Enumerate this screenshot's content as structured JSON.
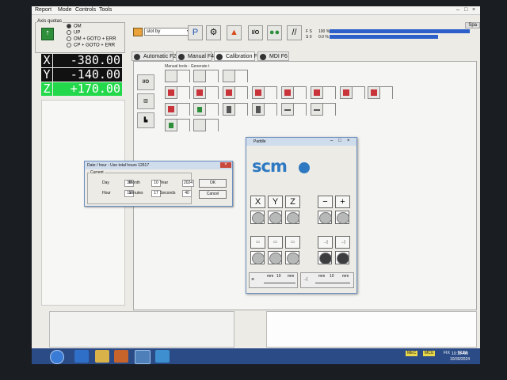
{
  "menu": {
    "items": [
      "Report",
      "Mode",
      "Controls",
      "Tools"
    ]
  },
  "axes_options": {
    "title": "Axis quotas",
    "options": [
      {
        "label": "OM",
        "selected": true
      },
      {
        "label": "UP",
        "selected": false
      },
      {
        "label": "OM + GOTO + ERR",
        "selected": false
      },
      {
        "label": "CP + GOTO + ERR",
        "selected": false
      }
    ]
  },
  "coords": [
    {
      "axis": "X",
      "value": "-380.00"
    },
    {
      "axis": "Y",
      "value": "-140.00"
    },
    {
      "axis": "Z",
      "value": "+170.00"
    }
  ],
  "toolbar": {
    "mode_select": "slot by"
  },
  "status": {
    "rows": [
      {
        "label": "F S",
        "text": "100 %",
        "fill": 0.93
      },
      {
        "label": "S 0",
        "text": "0.0 %",
        "fill": 0.72
      }
    ],
    "panel_title": "Spa"
  },
  "tabs": [
    {
      "label": "Automatic F2",
      "active": false
    },
    {
      "label": "Manual F4",
      "active": false
    },
    {
      "label": "Calibration F5",
      "active": true
    },
    {
      "label": "MDI F6",
      "active": false
    }
  ],
  "main": {
    "group_label": "Manual tools - Generate t"
  },
  "date_dialog": {
    "title": "Date / hour - Use total hours 12617",
    "group_title": "Current",
    "fields": [
      {
        "label": "Day",
        "value": "30"
      },
      {
        "label": "Month",
        "value": "10"
      },
      {
        "label": "Year",
        "value": "2024"
      },
      {
        "label": "Hour",
        "value": "11"
      },
      {
        "label": "Minutes",
        "value": "17"
      },
      {
        "label": "Seconds",
        "value": "40"
      }
    ],
    "ok": "OK",
    "cancel": "Cancel"
  },
  "pendant": {
    "title": "Paddle",
    "logo": "scm",
    "axis_keys": [
      "X",
      "Y",
      "Z"
    ],
    "sign_keys": [
      "−",
      "+"
    ],
    "speed_label": "mm",
    "speed_value": "10",
    "speed_label_right": "mm"
  },
  "taskbar": {
    "tray_labels": [
      "MEC",
      "MCU",
      "FIX",
      "NUM"
    ],
    "time": "10:18 AM",
    "date": "10/30/2024"
  },
  "colors": {
    "z_highlight": "#23d84a",
    "accent": "#2c5fc9",
    "logo": "#2e79c2"
  }
}
